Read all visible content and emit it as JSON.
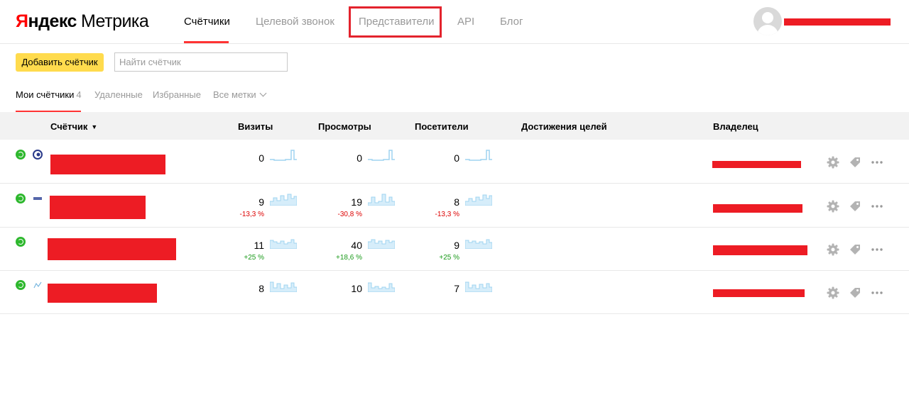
{
  "header": {
    "logo_brand_first": "Я",
    "logo_brand_rest": "ндекс",
    "logo_product": "Метрика",
    "nav": [
      {
        "label": "Счётчики",
        "active": true
      },
      {
        "label": "Целевой звонок",
        "active": false
      },
      {
        "label": "Представители",
        "active": false
      },
      {
        "label": "API",
        "active": false
      },
      {
        "label": "Блог",
        "active": false
      }
    ],
    "highlight_color": "#e3232d",
    "redaction_color": "#ed1c24"
  },
  "toolbar": {
    "add_label": "Добавить счётчик",
    "search_placeholder": "Найти счётчик",
    "search_value": ""
  },
  "tabs": {
    "my_label": "Мои счётчики",
    "my_count": "4",
    "deleted_label": "Удаленные",
    "favorites_label": "Избранные",
    "all_tags_label": "Все метки"
  },
  "table": {
    "columns": {
      "counter": "Счётчик",
      "sort_mark": "▼",
      "visits": "Визиты",
      "views": "Просмотры",
      "visitors": "Посетители",
      "goals": "Достижения целей",
      "owner": "Владелец"
    },
    "rows": [
      {
        "status": "active",
        "favicon": "blue-swirl-favicon",
        "visits": "0",
        "visits_delta": "",
        "views": "0",
        "views_delta": "",
        "visitors": "0",
        "visitors_delta": ""
      },
      {
        "status": "active",
        "favicon": "small-logo-favicon",
        "visits": "9",
        "visits_delta": "-13,3 %",
        "views": "19",
        "views_delta": "-30,8 %",
        "visitors": "8",
        "visitors_delta": "-13,3 %"
      },
      {
        "status": "active",
        "favicon": "",
        "visits": "11",
        "visits_delta": "+25 %",
        "views": "40",
        "views_delta": "+18,6 %",
        "visitors": "9",
        "visitors_delta": "+25 %"
      },
      {
        "status": "active",
        "favicon": "chart-favicon",
        "visits": "8",
        "visits_delta": "",
        "views": "10",
        "views_delta": "",
        "visitors": "7",
        "visitors_delta": ""
      }
    ]
  },
  "colors": {
    "accent": "#ff3333",
    "button": "#ffdb4d",
    "status_ok": "#2eb82e",
    "sparkline": "#9fd4f0",
    "negative": "#dd0000",
    "positive": "#1a9a1a"
  }
}
